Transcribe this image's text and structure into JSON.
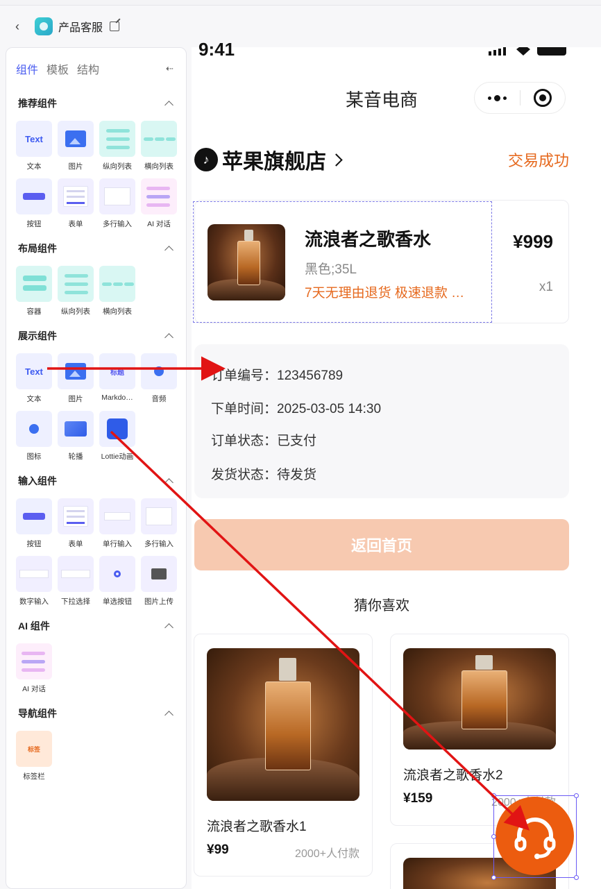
{
  "topbar": {
    "back": "‹",
    "title": "产品客服"
  },
  "panel": {
    "tabs": [
      "组件",
      "模板",
      "结构"
    ],
    "collapse_icon": "⇠",
    "sections": {
      "recommended": {
        "title": "推荐组件",
        "items": [
          "文本",
          "图片",
          "纵向列表",
          "横向列表",
          "按钮",
          "表单",
          "多行输入",
          "AI 对话"
        ]
      },
      "layout": {
        "title": "布局组件",
        "items": [
          "容器",
          "纵向列表",
          "横向列表"
        ]
      },
      "display": {
        "title": "展示组件",
        "items": [
          "文本",
          "图片",
          "Markdo…",
          "音频",
          "图标",
          "轮播",
          "Lottie动画"
        ]
      },
      "input": {
        "title": "输入组件",
        "items": [
          "按钮",
          "表单",
          "单行输入",
          "多行输入",
          "数字输入",
          "下拉选择",
          "单选按钮",
          "图片上传"
        ]
      },
      "ai": {
        "title": "AI 组件",
        "items": [
          "AI 对话"
        ]
      },
      "nav": {
        "title": "导航组件",
        "items": [
          "标签栏"
        ]
      }
    },
    "thumb_text": "Text",
    "thumb_tab": "标签",
    "thumb_md": "标题"
  },
  "phone": {
    "time": "9:41",
    "nav_title": "某音电商",
    "store_name": "苹果旗舰店",
    "trade_status": "交易成功",
    "product": {
      "name": "流浪者之歌香水",
      "spec": "黑色;35L",
      "promo": "7天无理由退货 极速退款 …",
      "price": "¥999",
      "qty": "x1"
    },
    "order": {
      "number": "订单编号：123456789",
      "time": "下单时间：2025-03-05 14:30",
      "status": "订单状态：已支付",
      "ship": "发货状态：待发货"
    },
    "home_button": "返回首页",
    "guess_title": "猜你喜欢",
    "recommendations": [
      {
        "name": "流浪者之歌香水1",
        "price": "¥99",
        "sold": "2000+人付款"
      },
      {
        "name": "流浪者之歌香水2",
        "price": "¥159",
        "sold": "2000+人付款"
      }
    ]
  },
  "colors": {
    "accent": "#4a5cf0",
    "orange": "#e6691e",
    "fab": "#ec5c0f",
    "arrow": "#e11414",
    "home_button": "#f7c9b0"
  }
}
